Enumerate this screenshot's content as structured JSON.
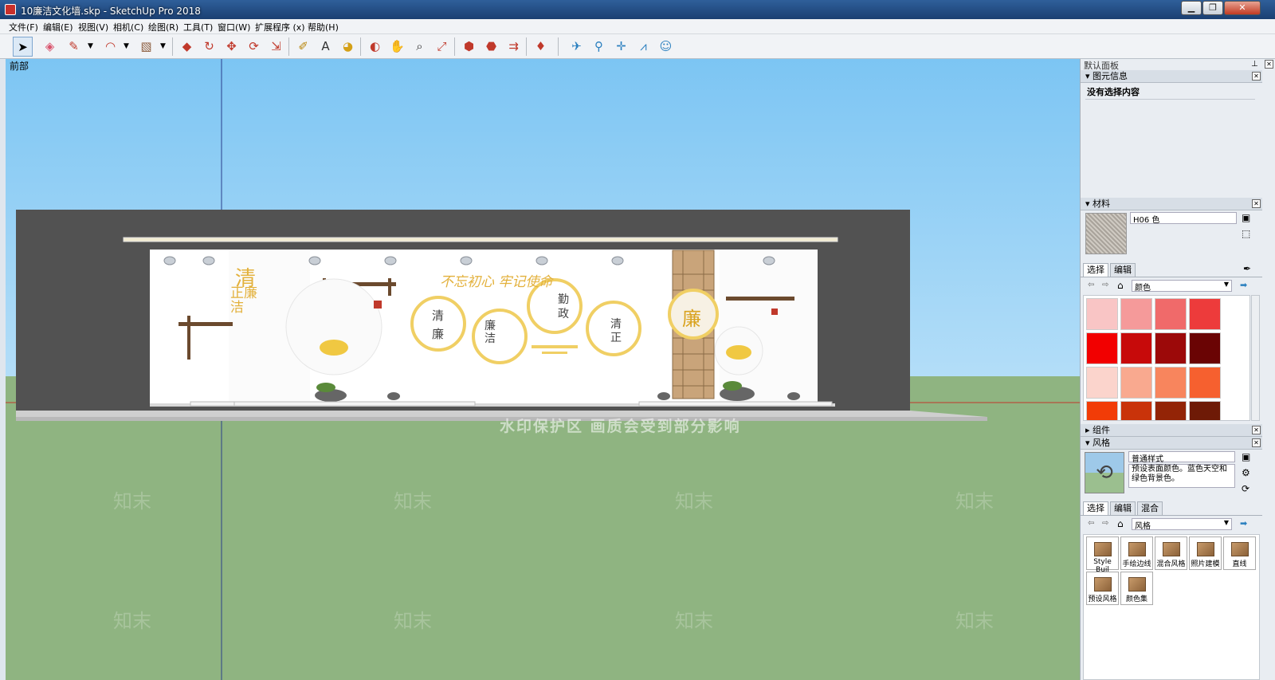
{
  "window": {
    "title": "10廉洁文化墙.skp - SketchUp Pro 2018"
  },
  "menu": [
    "文件(F)",
    "编辑(E)",
    "视图(V)",
    "相机(C)",
    "绘图(R)",
    "工具(T)",
    "窗口(W)",
    "扩展程序 (x)",
    "帮助(H)"
  ],
  "viewport": {
    "view_label": "前部",
    "watermark": "水印保护区  画质会受到部分影响",
    "wm_text": "知末"
  },
  "scene": {
    "title_calligraphy": "不忘初心 牢记使命",
    "side_calligraphy_1": "清",
    "side_calligraphy_2": "正廉洁",
    "circle1_a": "清",
    "circle1_b": "廉",
    "circle2_a": "廉洁",
    "circle3_a": "勤",
    "circle3_b": "政",
    "circle4_a": "清",
    "circle4_b": "正",
    "screen_char": "廉"
  },
  "panel": {
    "tray_title": "默认面板",
    "entity_info": {
      "header": "图元信息",
      "status": "没有选择内容"
    },
    "materials": {
      "header": "材料",
      "material_name": "H06 色",
      "tab_select": "选择",
      "tab_edit": "编辑",
      "library": "颜色",
      "swatches": [
        "#f9c5c5",
        "#f59a9a",
        "#f06a6a",
        "#ed3b3b",
        "#f20000",
        "#c70a0a",
        "#9c0909",
        "#6a0404",
        "#fbd4cc",
        "#f9a98f",
        "#f8855d",
        "#f6602f",
        "#f23c07",
        "#c9330a",
        "#932406",
        "#6e1a06"
      ]
    },
    "components": {
      "header": "组件"
    },
    "styles": {
      "header": "风格",
      "style_name": "普通样式",
      "style_desc": "预设表面颜色。蓝色天空和绿色背景色。",
      "tab_select": "选择",
      "tab_edit": "编辑",
      "tab_mix": "混合",
      "library": "风格",
      "thumbs": [
        "Style Buil",
        "手绘边线",
        "混合风格",
        "照片建模",
        "直线",
        "预设风格",
        "颜色集"
      ]
    }
  }
}
